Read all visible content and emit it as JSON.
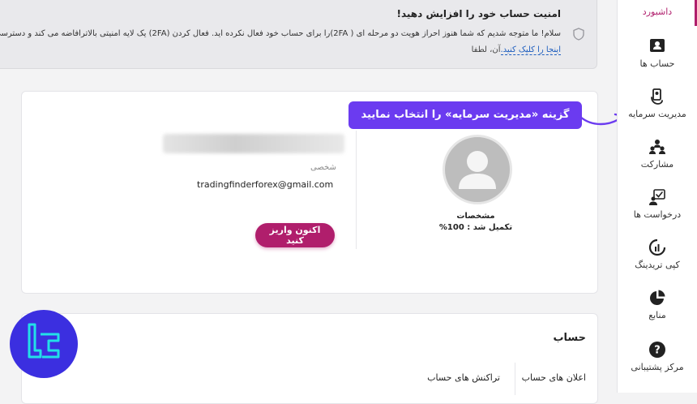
{
  "sidebar": {
    "items": [
      {
        "label": "داشبورد",
        "icon": "dashboard-icon"
      },
      {
        "label": "حساب ها",
        "icon": "accounts-icon"
      },
      {
        "label": "مدیریت سرمایه",
        "icon": "wallet-hand-icon"
      },
      {
        "label": "مشارکت",
        "icon": "partnership-icon"
      },
      {
        "label": "درخواست ها",
        "icon": "requests-icon"
      },
      {
        "label": "کپی تریدینگ",
        "icon": "copy-trading-icon"
      },
      {
        "label": "منابع",
        "icon": "resources-icon"
      },
      {
        "label": "مرکز پشتیبانی",
        "icon": "support-icon"
      }
    ],
    "active_index": 0
  },
  "alert": {
    "title": "امنیت حساب خود را افزایش دهید!",
    "body": "سلام! ما متوجه شدیم که شما هنوز احراز هویت دو مرحله ای ( 2FA)را برای حساب خود فعال نکرده اید. فعال کردن (2FA) یک لایه امنیتی بالاترافاضه می کند و دسترسی به اح",
    "link_prefix": "آن، لطفا ",
    "link_text": "اینجا را کلیک کنید."
  },
  "profile": {
    "title": "مشخصات",
    "completion": "تکمیل شد : 100%",
    "account_kind": "شخصی",
    "email": "tradingfinderforex@gmail.com",
    "deposit_button": "اکنون واریز کنید"
  },
  "callout": {
    "text": "گزینه «مدیریت سرمایه» را انتخاب نمایید"
  },
  "account": {
    "title": "حساب",
    "tabs": [
      {
        "label": "اعلان های حساب",
        "active": true
      },
      {
        "label": "تراکنش های حساب",
        "active": false
      }
    ]
  },
  "colors": {
    "brand": "#b01e6c",
    "callout": "#6b3bf0",
    "logo": "#3b2fe0"
  }
}
